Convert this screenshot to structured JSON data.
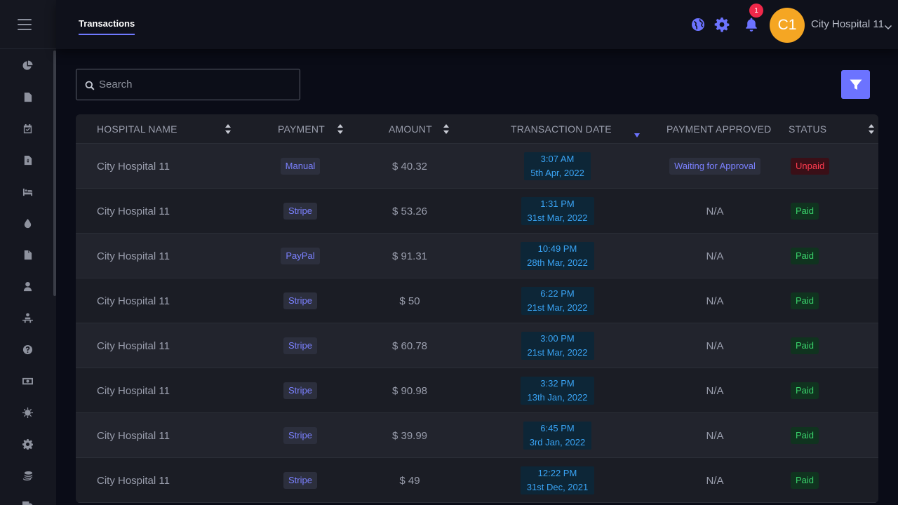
{
  "header": {
    "active_tab": "Transactions",
    "notification_count": "1",
    "avatar_initials": "C1",
    "user_name": "City Hospital 11"
  },
  "search": {
    "placeholder": "Search",
    "value": ""
  },
  "sidebar": {
    "icons": [
      "pie-chart-icon",
      "document-icon",
      "calendar-check-icon",
      "invoice-dollar-icon",
      "bed-icon",
      "blood-drop-icon",
      "file-icon",
      "user-doctor-icon",
      "patient-icon",
      "question-icon",
      "money-icon",
      "virus-icon",
      "gear-icon",
      "coins-icon",
      "truck-icon"
    ]
  },
  "table": {
    "columns": [
      {
        "label": "HOSPITAL NAME"
      },
      {
        "label": "PAYMENT"
      },
      {
        "label": "AMOUNT"
      },
      {
        "label": "TRANSACTION DATE"
      },
      {
        "label": "PAYMENT APPROVED"
      },
      {
        "label": "STATUS"
      }
    ],
    "rows": [
      {
        "hospital": "City Hospital 11",
        "payment": "Manual",
        "amount": "$ 40.32",
        "time": "3:07 AM",
        "date": "5th Apr, 2022",
        "approved": "Waiting for Approval",
        "status": "Unpaid"
      },
      {
        "hospital": "City Hospital 11",
        "payment": "Stripe",
        "amount": "$ 53.26",
        "time": "1:31 PM",
        "date": "31st Mar, 2022",
        "approved": "N/A",
        "status": "Paid"
      },
      {
        "hospital": "City Hospital 11",
        "payment": "PayPal",
        "amount": "$ 91.31",
        "time": "10:49 PM",
        "date": "28th Mar, 2022",
        "approved": "N/A",
        "status": "Paid"
      },
      {
        "hospital": "City Hospital 11",
        "payment": "Stripe",
        "amount": "$ 50",
        "time": "6:22 PM",
        "date": "21st Mar, 2022",
        "approved": "N/A",
        "status": "Paid"
      },
      {
        "hospital": "City Hospital 11",
        "payment": "Stripe",
        "amount": "$ 60.78",
        "time": "3:00 PM",
        "date": "21st Mar, 2022",
        "approved": "N/A",
        "status": "Paid"
      },
      {
        "hospital": "City Hospital 11",
        "payment": "Stripe",
        "amount": "$ 90.98",
        "time": "3:32 PM",
        "date": "13th Jan, 2022",
        "approved": "N/A",
        "status": "Paid"
      },
      {
        "hospital": "City Hospital 11",
        "payment": "Stripe",
        "amount": "$ 39.99",
        "time": "6:45 PM",
        "date": "3rd Jan, 2022",
        "approved": "N/A",
        "status": "Paid"
      },
      {
        "hospital": "City Hospital 11",
        "payment": "Stripe",
        "amount": "$ 49",
        "time": "12:22 PM",
        "date": "31st Dec, 2021",
        "approved": "N/A",
        "status": "Paid"
      }
    ]
  },
  "colors": {
    "accent": "#6c73ff",
    "paid": "#3ad36c",
    "unpaid": "#ff3b4f",
    "date": "#3aa4f5",
    "avatar": "#f5a623"
  }
}
